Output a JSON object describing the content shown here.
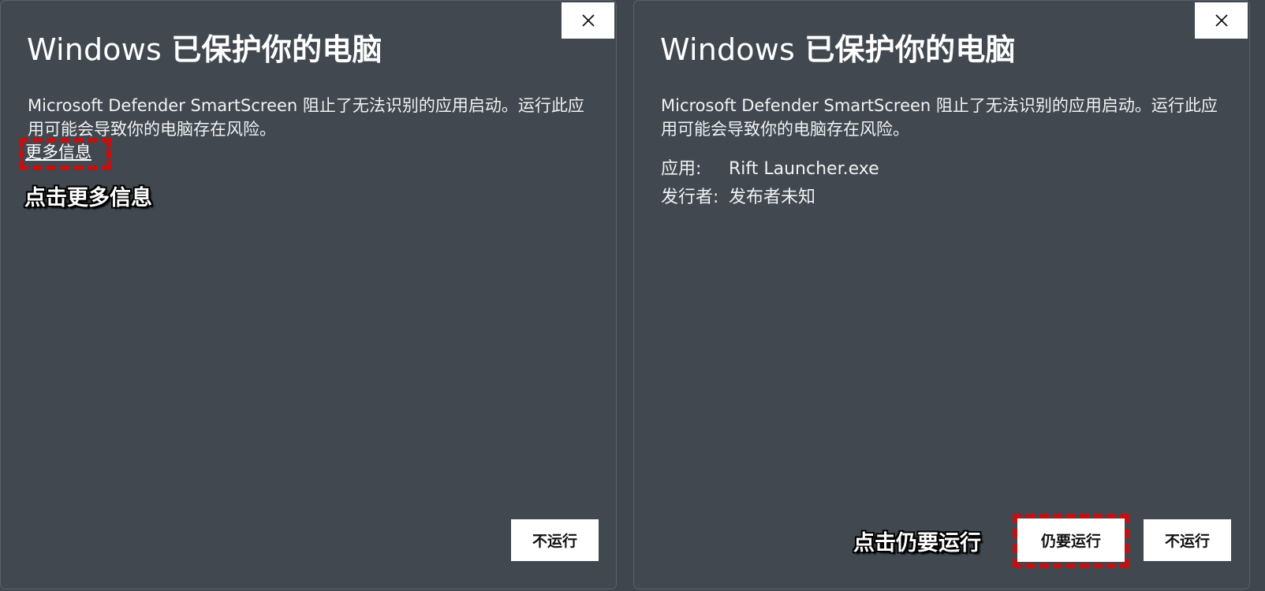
{
  "title_prefix": "Windows",
  "title_strong": "已保护你的电脑",
  "description": "Microsoft Defender SmartScreen 阻止了无法识别的应用启动。运行此应用可能会导致你的电脑存在风险。",
  "more_info_link": "更多信息",
  "annotation_left": "点击更多信息",
  "annotation_right": "点击仍要运行",
  "dont_run_label": "不运行",
  "run_anyway_label": "仍要运行",
  "app_label": "应用:",
  "app_value": "Rift Launcher.exe",
  "publisher_label": "发行者:",
  "publisher_value": "发布者未知",
  "close_icon": "close-icon",
  "colors": {
    "background": "#414850",
    "highlight": "#c01212",
    "button": "#ffffff"
  }
}
